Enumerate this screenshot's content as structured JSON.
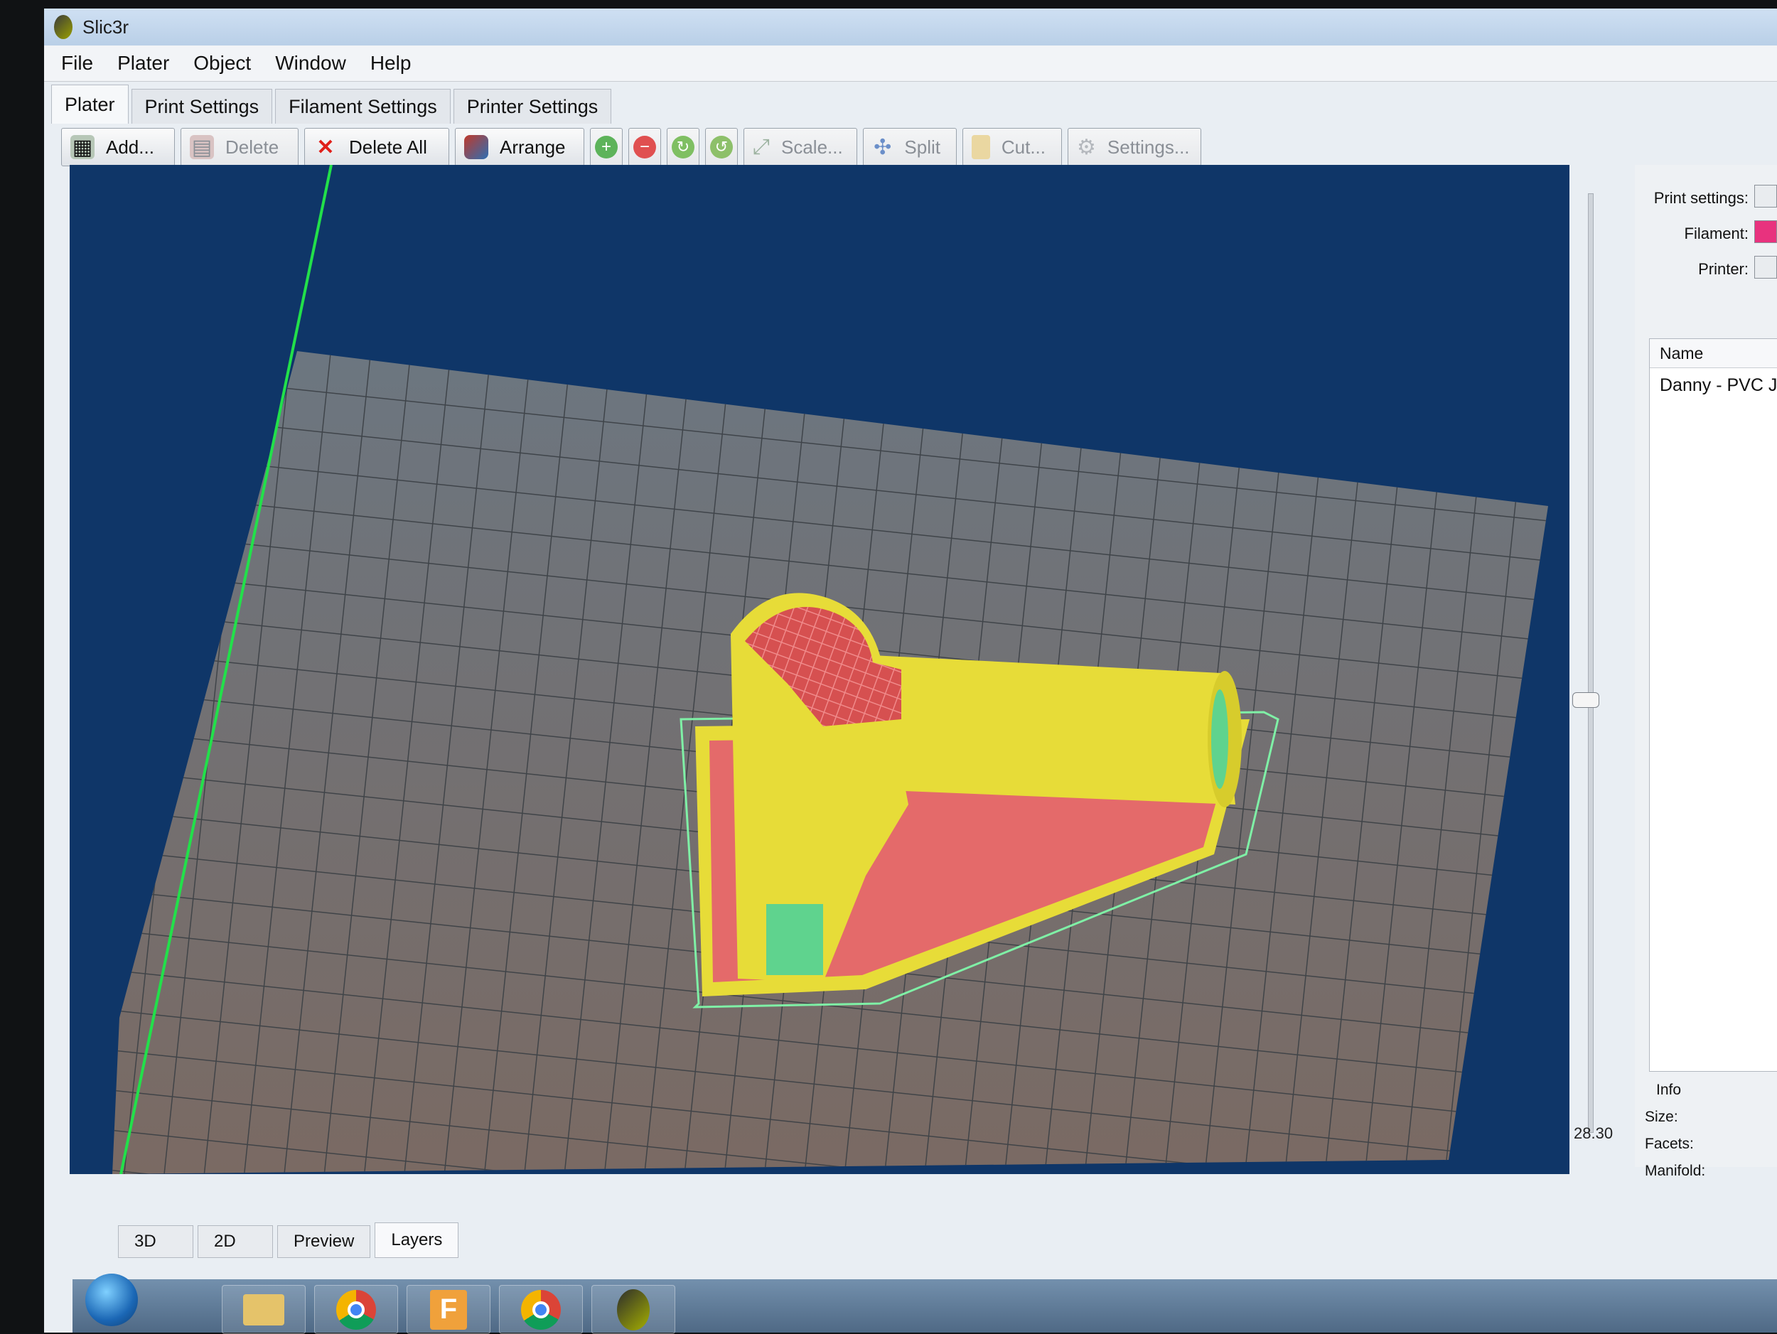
{
  "window": {
    "title": "Slic3r"
  },
  "menu": [
    "File",
    "Plater",
    "Object",
    "Window",
    "Help"
  ],
  "tabs": [
    "Plater",
    "Print Settings",
    "Filament Settings",
    "Printer Settings"
  ],
  "toolbar": {
    "add": "Add...",
    "delete": "Delete",
    "delete_all": "Delete All",
    "arrange": "Arrange",
    "scale": "Scale...",
    "split": "Split",
    "cut": "Cut...",
    "settings": "Settings..."
  },
  "right_panel": {
    "print_settings_label": "Print settings:",
    "filament_label": "Filament:",
    "printer_label": "Printer:",
    "filament_color": "#e8327e",
    "object_list": {
      "header": "Name",
      "items": [
        "Danny - PVC Jo"
      ]
    },
    "info": {
      "title": "Info",
      "size_label": "Size:",
      "facets_label": "Facets:",
      "manifold_label": "Manifold:"
    }
  },
  "layer_slider": {
    "value": "28.30"
  },
  "view_tabs": [
    "3D",
    "2D",
    "Preview",
    "Layers"
  ],
  "colors": {
    "viewport_bg": "#0f3668",
    "bed": "#6e767d",
    "perimeter": "#e7dc38",
    "infill": "#e46a6a",
    "support": "#5fd38e",
    "skirt": "#7ff0a6"
  }
}
